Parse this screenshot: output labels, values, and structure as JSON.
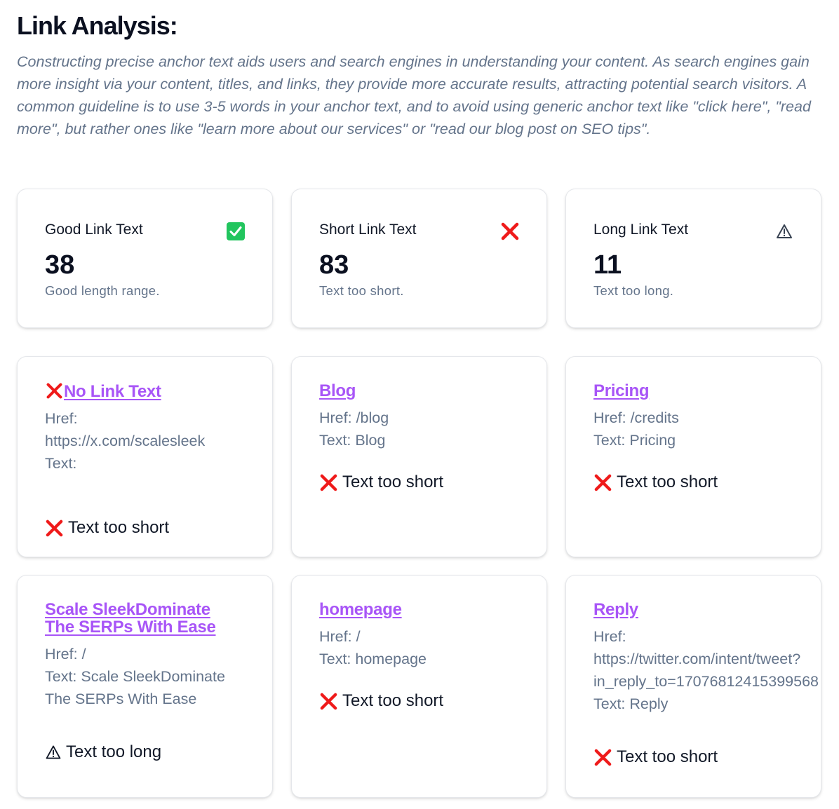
{
  "heading": "Link Analysis:",
  "intro": "Constructing precise anchor text aids users and search engines in understanding your content. As search engines gain more insight via your content, titles, and links, they provide more accurate results, attracting potential search visitors. A common guideline is to use 3-5 words in your anchor text, and to avoid using generic anchor text like \"click here\", \"read more\", but rather ones like \"learn more about our services\" or \"read our blog post on SEO tips\".",
  "stats": [
    {
      "title": "Good Link Text",
      "value": "38",
      "desc": "Good length range.",
      "icon": "check-icon"
    },
    {
      "title": "Short Link Text",
      "value": "83",
      "desc": "Text too short.",
      "icon": "cross-icon"
    },
    {
      "title": "Long Link Text",
      "value": "11",
      "desc": "Text too long.",
      "icon": "warning-icon"
    }
  ],
  "links": [
    {
      "title": "No Link Text",
      "href_label": "Href:",
      "href": "https://x.com/scalesleek",
      "text_label": "Text:",
      "text": "",
      "verdict": "Text too short"
    },
    {
      "title": "Blog",
      "href_label": "Href:",
      "href": "/blog",
      "text_label": "Text:",
      "text": "Blog",
      "verdict": "Text too short"
    },
    {
      "title": "Pricing",
      "href_label": "Href:",
      "href": "/credits",
      "text_label": "Text:",
      "text": "Pricing",
      "verdict": "Text too short"
    },
    {
      "title_line1": "Scale SleekDominate",
      "title_line2": "The SERPs With Ease",
      "href_label": "Href:",
      "href": "/",
      "text_label": "Text:",
      "text_line1": "Scale SleekDominate",
      "text_line2": "The SERPs With Ease",
      "verdict": "Text too long"
    },
    {
      "title": "homepage",
      "href_label": "Href:",
      "href": "/",
      "text_label": "Text:",
      "text": "homepage",
      "verdict": "Text too short"
    },
    {
      "title": "Reply",
      "href_label": "Href:",
      "href_line1": "https://twitter.com/intent/tweet?",
      "href_line2": "in_reply_to=17076812415399568",
      "text_label": "Text:",
      "text": "Reply",
      "verdict": "Text too short"
    }
  ],
  "colors": {
    "link": "#a855f7",
    "muted": "#64748b",
    "cross": "#ef1a1a",
    "check": "#22c55e"
  }
}
